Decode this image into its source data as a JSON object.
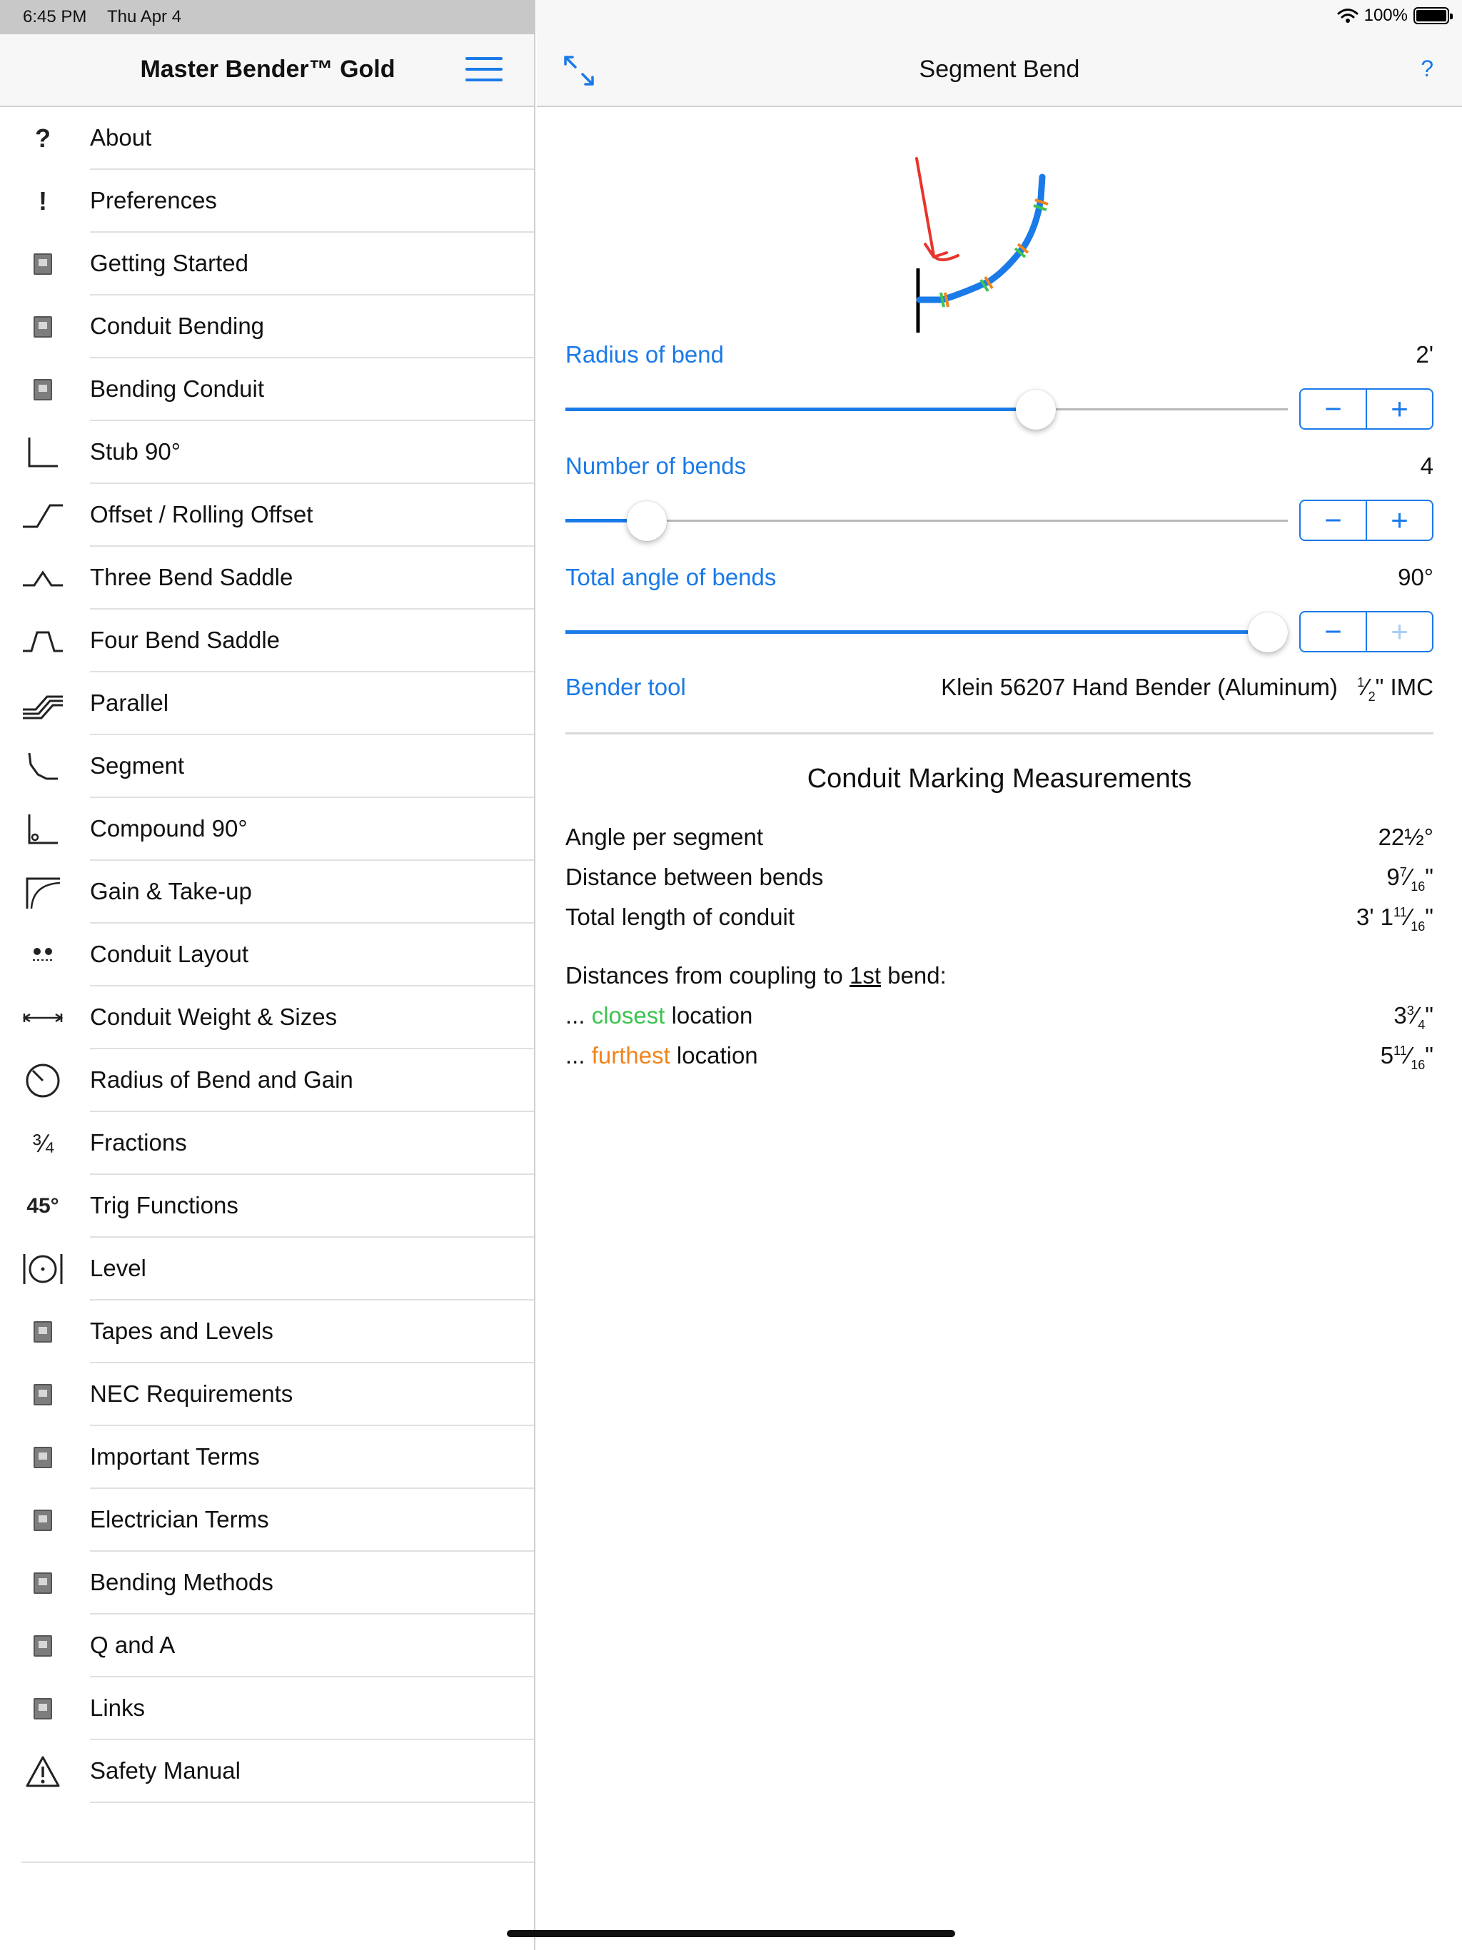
{
  "status_bar": {
    "time": "6:45 PM",
    "date": "Thu Apr 4",
    "battery": "100%"
  },
  "sidebar": {
    "title": "Master Bender™ Gold",
    "items": [
      {
        "label": "About",
        "icon": "question-icon"
      },
      {
        "label": "Preferences",
        "icon": "exclamation-icon"
      },
      {
        "label": "Getting Started",
        "icon": "book-icon"
      },
      {
        "label": "Conduit Bending",
        "icon": "book-icon"
      },
      {
        "label": "Bending Conduit",
        "icon": "book-icon"
      },
      {
        "label": "Stub 90°",
        "icon": "stub-90-icon"
      },
      {
        "label": "Offset / Rolling Offset",
        "icon": "offset-icon"
      },
      {
        "label": "Three Bend Saddle",
        "icon": "three-bend-saddle-icon"
      },
      {
        "label": "Four Bend Saddle",
        "icon": "four-bend-saddle-icon"
      },
      {
        "label": "Parallel",
        "icon": "parallel-icon"
      },
      {
        "label": "Segment",
        "icon": "segment-icon"
      },
      {
        "label": "Compound 90°",
        "icon": "compound-90-icon"
      },
      {
        "label": "Gain & Take-up",
        "icon": "gain-takeup-icon"
      },
      {
        "label": "Conduit Layout",
        "icon": "conduit-layout-icon"
      },
      {
        "label": "Conduit Weight & Sizes",
        "icon": "weight-sizes-icon"
      },
      {
        "label": "Radius of Bend and Gain",
        "icon": "radius-gauge-icon"
      },
      {
        "label": "Fractions",
        "icon": "fraction-icon",
        "glyph": "¾"
      },
      {
        "label": "Trig Functions",
        "icon": "trig-icon",
        "glyph": "45°"
      },
      {
        "label": "Level",
        "icon": "level-icon"
      },
      {
        "label": "Tapes and Levels",
        "icon": "book-icon"
      },
      {
        "label": "NEC Requirements",
        "icon": "book-icon"
      },
      {
        "label": "Important Terms",
        "icon": "book-icon"
      },
      {
        "label": "Electrician Terms",
        "icon": "book-icon"
      },
      {
        "label": "Bending Methods",
        "icon": "book-icon"
      },
      {
        "label": "Q and A",
        "icon": "book-icon"
      },
      {
        "label": "Links",
        "icon": "book-icon"
      },
      {
        "label": "Safety Manual",
        "icon": "warning-icon"
      }
    ]
  },
  "main": {
    "title": "Segment Bend",
    "help": "?",
    "radius": {
      "label": "Radius of bend",
      "value": "2'",
      "level": 0.66
    },
    "bends": {
      "label": "Number of bends",
      "value": "4",
      "level": 0.09
    },
    "angle": {
      "label": "Total angle of bends",
      "value": "90°",
      "level": 1.0
    },
    "bender": {
      "label": "Bender tool",
      "tool": "Klein 56207 Hand Bender (Aluminum)",
      "size_num": "1",
      "size_den": "2",
      "size_suffix": "\" IMC"
    },
    "measurements": {
      "title": "Conduit Marking Measurements",
      "angle_per_segment": {
        "label": "Angle per segment",
        "value": "22½°"
      },
      "distance_between": {
        "label": "Distance between bends",
        "whole": "9",
        "num": "7",
        "den": "16",
        "suffix": "\""
      },
      "total_length": {
        "label": "Total length of conduit",
        "whole": "3' 1",
        "num": "11",
        "den": "16",
        "suffix": "\""
      },
      "coupling_heading": {
        "pre": "Distances from coupling to ",
        "underlined": "1st",
        "post": " bend:"
      },
      "closest": {
        "prefix": "... ",
        "colored": "closest",
        "suffix_text": " location",
        "whole": "3",
        "num": "3",
        "den": "4",
        "suffix": "\""
      },
      "furthest": {
        "prefix": "... ",
        "colored": "furthest",
        "suffix_text": " location",
        "whole": "5",
        "num": "11",
        "den": "16",
        "suffix": "\""
      }
    }
  }
}
